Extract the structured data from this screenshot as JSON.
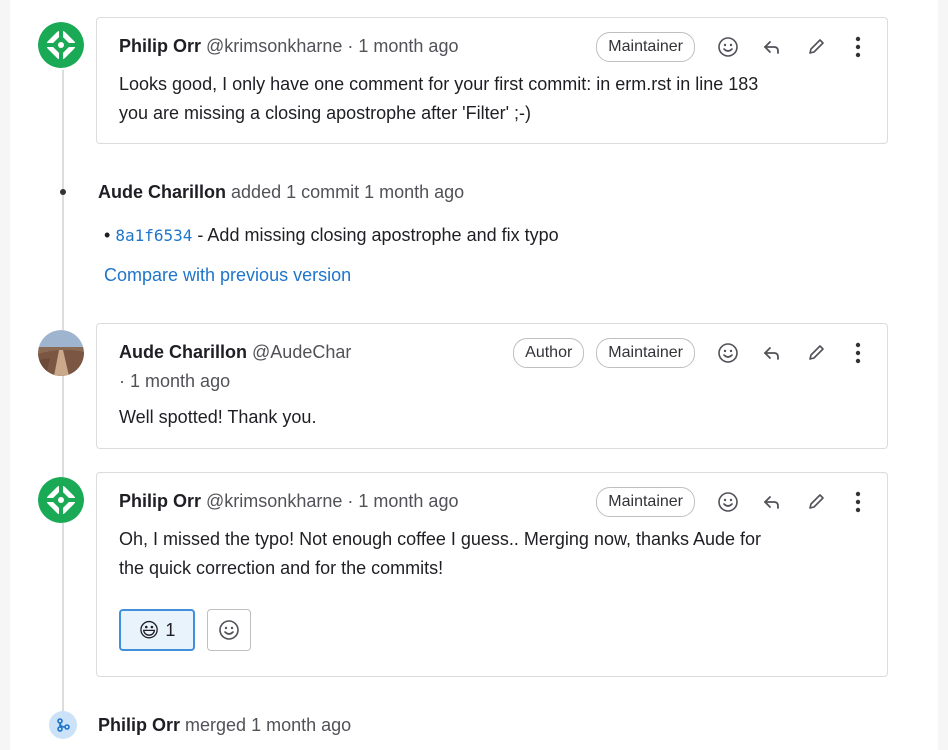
{
  "notes": [
    {
      "author": "Philip Orr",
      "username": "@krimsonkharne",
      "separator": "·",
      "time": "1 month ago",
      "badges": [
        "Maintainer"
      ],
      "body_lines": [
        "Looks good, I only have one comment for your first commit: in erm.rst in line 183",
        "you are missing a closing apostrophe after 'Filter' ;-)"
      ],
      "avatar_icon": "gitlab-avatar-icon"
    },
    {
      "author": "Aude Charillon",
      "username": "@AudeChar",
      "separator": "·",
      "time": "1 month ago",
      "badges": [
        "Author",
        "Maintainer"
      ],
      "body_lines": [
        "Well spotted! Thank you."
      ],
      "avatar_icon": "photo-avatar"
    },
    {
      "author": "Philip Orr",
      "username": "@krimsonkharne",
      "separator": "·",
      "time": "1 month ago",
      "badges": [
        "Maintainer"
      ],
      "body_lines": [
        "Oh, I missed the typo! Not enough coffee I guess.. Merging now, thanks Aude for",
        "the quick correction and for the commits!"
      ],
      "reaction": {
        "emoji": "😃",
        "count": "1"
      },
      "avatar_icon": "gitlab-avatar-icon"
    }
  ],
  "system_commit": {
    "author": "Aude Charillon",
    "action": "added 1 commit",
    "time": "1 month ago",
    "bullet": "•",
    "sha": "8a1f6534",
    "dash": "-",
    "message": "Add missing closing apostrophe and fix typo",
    "compare_link": "Compare with previous version"
  },
  "system_merge": {
    "author": "Philip Orr",
    "action": "merged",
    "time": "1 month ago"
  },
  "colors": {
    "link": "#1f75cb",
    "avatar_green": "#1aaa55",
    "reaction_border": "#428fdc"
  }
}
